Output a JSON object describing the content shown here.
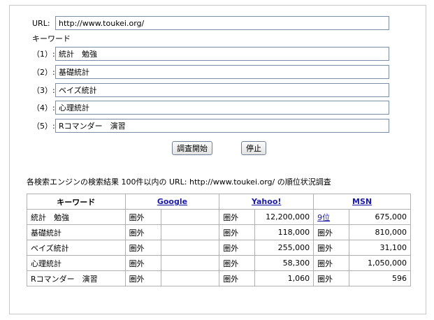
{
  "form": {
    "url_label": "URL:",
    "url_value": "http://www.toukei.org/",
    "keyword_heading": "キーワード",
    "keywords": [
      {
        "label": "（1）:",
        "value": "統計　勉強"
      },
      {
        "label": "（2）:",
        "value": "基礎統計"
      },
      {
        "label": "（3）:",
        "value": "ベイズ統計"
      },
      {
        "label": "（4）:",
        "value": "心理統計"
      },
      {
        "label": "（5）:",
        "value": "Rコマンダー　演習"
      }
    ],
    "start_button": "調査開始",
    "stop_button": "停止"
  },
  "results": {
    "caption": "各検索エンジンの検索結果 100件以内の URL: http://www.toukei.org/ の順位状況調査",
    "headers": {
      "keyword": "キーワード",
      "google": "Google",
      "yahoo": "Yahoo!",
      "msn": "MSN"
    },
    "rows": [
      {
        "keyword": "統計　勉強",
        "google_rank": "圏外",
        "google_count": "",
        "yahoo_rank": "圏外",
        "yahoo_count": "12,200,000",
        "msn_rank": "9位",
        "msn_count": "675,000"
      },
      {
        "keyword": "基礎統計",
        "google_rank": "圏外",
        "google_count": "",
        "yahoo_rank": "圏外",
        "yahoo_count": "118,000",
        "msn_rank": "圏外",
        "msn_count": "810,000"
      },
      {
        "keyword": "ベイズ統計",
        "google_rank": "圏外",
        "google_count": "",
        "yahoo_rank": "圏外",
        "yahoo_count": "255,000",
        "msn_rank": "圏外",
        "msn_count": "31,100"
      },
      {
        "keyword": "心理統計",
        "google_rank": "圏外",
        "google_count": "",
        "yahoo_rank": "圏外",
        "yahoo_count": "58,300",
        "msn_rank": "圏外",
        "msn_count": "1,050,000"
      },
      {
        "keyword": "Rコマンダー　演習",
        "google_rank": "圏外",
        "google_count": "",
        "yahoo_rank": "圏外",
        "yahoo_count": "1,060",
        "msn_rank": "圏外",
        "msn_count": "596"
      }
    ],
    "link_color": "#1a1aa6"
  }
}
